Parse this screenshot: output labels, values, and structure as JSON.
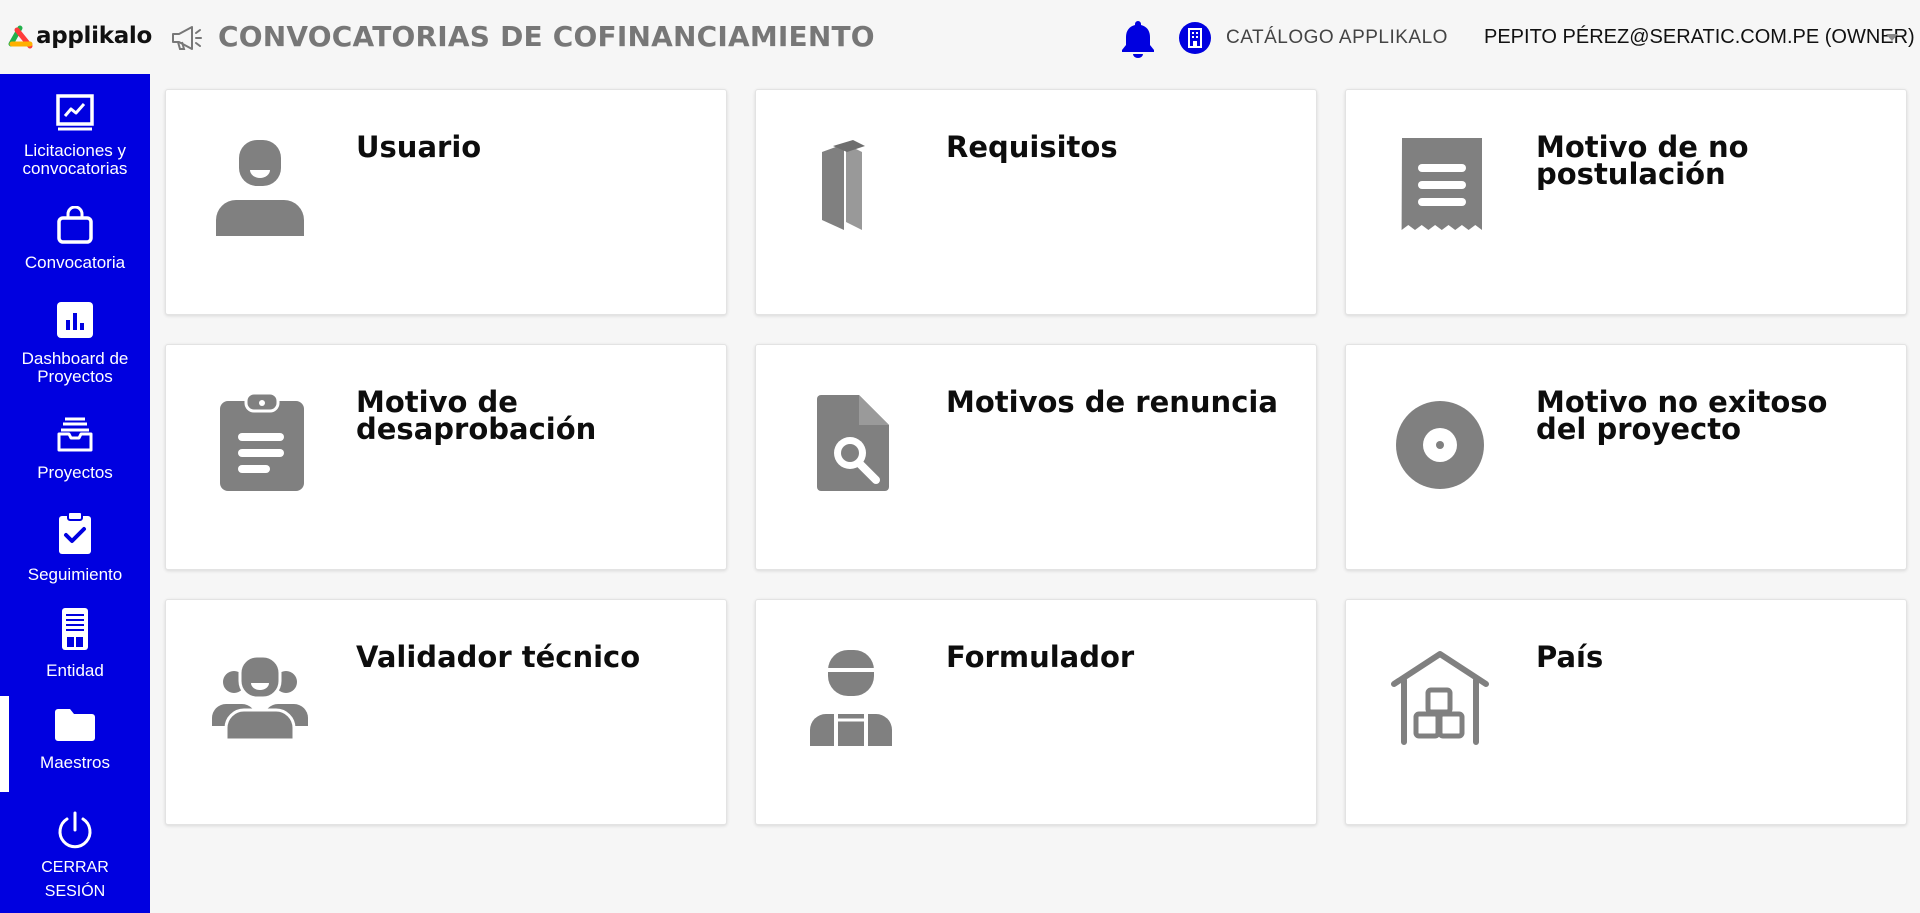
{
  "header": {
    "logo_text": "applikalo",
    "page_title": "CONVOCATORIAS DE COFINANCIAMIENTO",
    "catalog_label": "CATÁLOGO APPLIKALO",
    "user_label": "PEPITO PÉREZ@SERATIC.COM.PE (OWNER)",
    "icons": [
      "megaphone-icon",
      "bell-icon",
      "building-icon",
      "chevron-down-icon"
    ]
  },
  "sidebar": {
    "items": [
      {
        "label": "Licitaciones y convocatorias",
        "icon": "chart-icon"
      },
      {
        "label": "Convocatoria",
        "icon": "bag-icon"
      },
      {
        "label": "Dashboard de Proyectos",
        "icon": "bar-chart-icon"
      },
      {
        "label": "Proyectos",
        "icon": "inbox-icon"
      },
      {
        "label": "Seguimiento",
        "icon": "clipboard-check-icon"
      },
      {
        "label": "Entidad",
        "icon": "server-icon"
      },
      {
        "label": "Maestros",
        "icon": "folder-icon",
        "active": true
      }
    ],
    "logout_label_1": "CERRAR",
    "logout_label_2": "SESIÓN"
  },
  "cards": [
    {
      "title": "Usuario",
      "icon": "user-icon"
    },
    {
      "title": "Requisitos",
      "icon": "folded-paper-icon"
    },
    {
      "title": "Motivo de no postulación",
      "icon": "receipt-icon"
    },
    {
      "title": "Motivo de desaprobación",
      "icon": "clipboard-list-icon"
    },
    {
      "title": "Motivos de renuncia",
      "icon": "file-search-icon"
    },
    {
      "title": "Motivo no exitoso del proyecto",
      "icon": "disc-icon"
    },
    {
      "title": "Validador técnico",
      "icon": "users-icon"
    },
    {
      "title": "Formulador",
      "icon": "worker-icon"
    },
    {
      "title": "País",
      "icon": "warehouse-icon"
    }
  ],
  "colors": {
    "sidebar": "#0000e0",
    "accent": "#0000e0",
    "icon_gray": "#808080",
    "title_gray": "#777777",
    "background": "#f6f6f6"
  }
}
